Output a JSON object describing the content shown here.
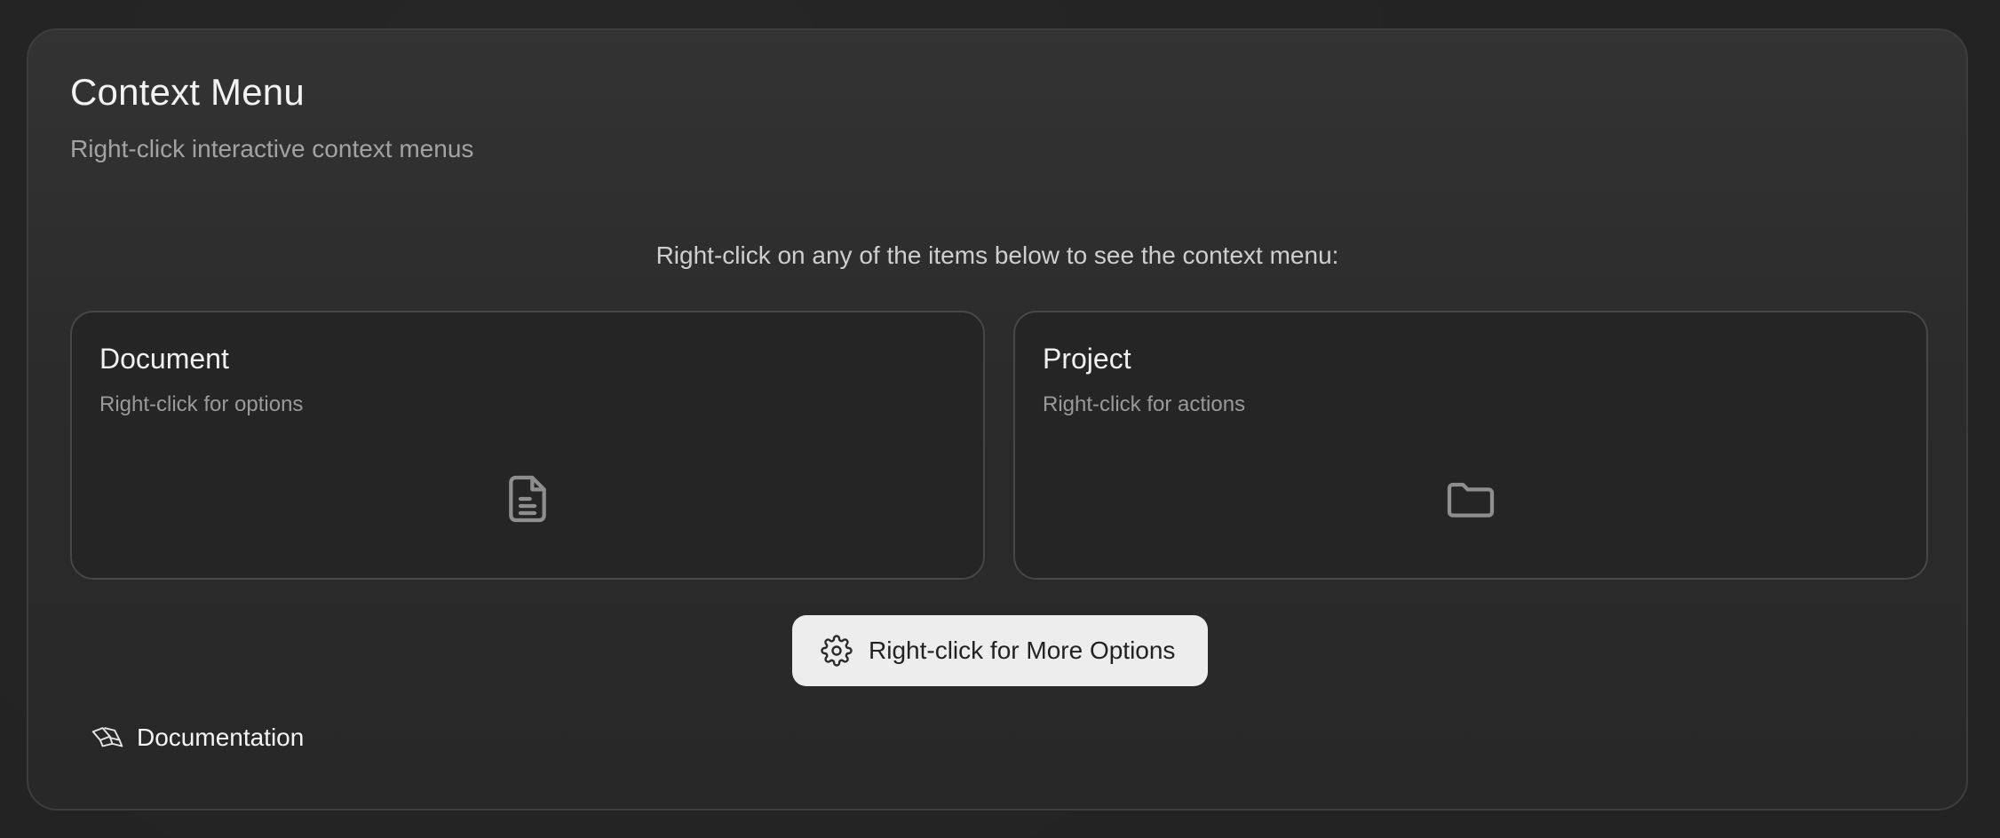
{
  "header": {
    "title": "Context Menu",
    "subtitle": "Right-click interactive context menus"
  },
  "instructions": "Right-click on any of the items below to see the context menu:",
  "cards": [
    {
      "title": "Document",
      "subtitle": "Right-click for options",
      "icon": "document-icon"
    },
    {
      "title": "Project",
      "subtitle": "Right-click for actions",
      "icon": "folder-icon"
    }
  ],
  "more_button": {
    "label": "Right-click for More Options",
    "icon": "gear-icon"
  },
  "footer": {
    "docs_label": "Documentation",
    "icon": "book-icon"
  },
  "colors": {
    "background": "#232323",
    "panel": "#2e2e2e",
    "card": "#252525",
    "button": "#ededed",
    "text_primary": "#f2f2f2",
    "text_secondary": "#a3a3a3"
  }
}
